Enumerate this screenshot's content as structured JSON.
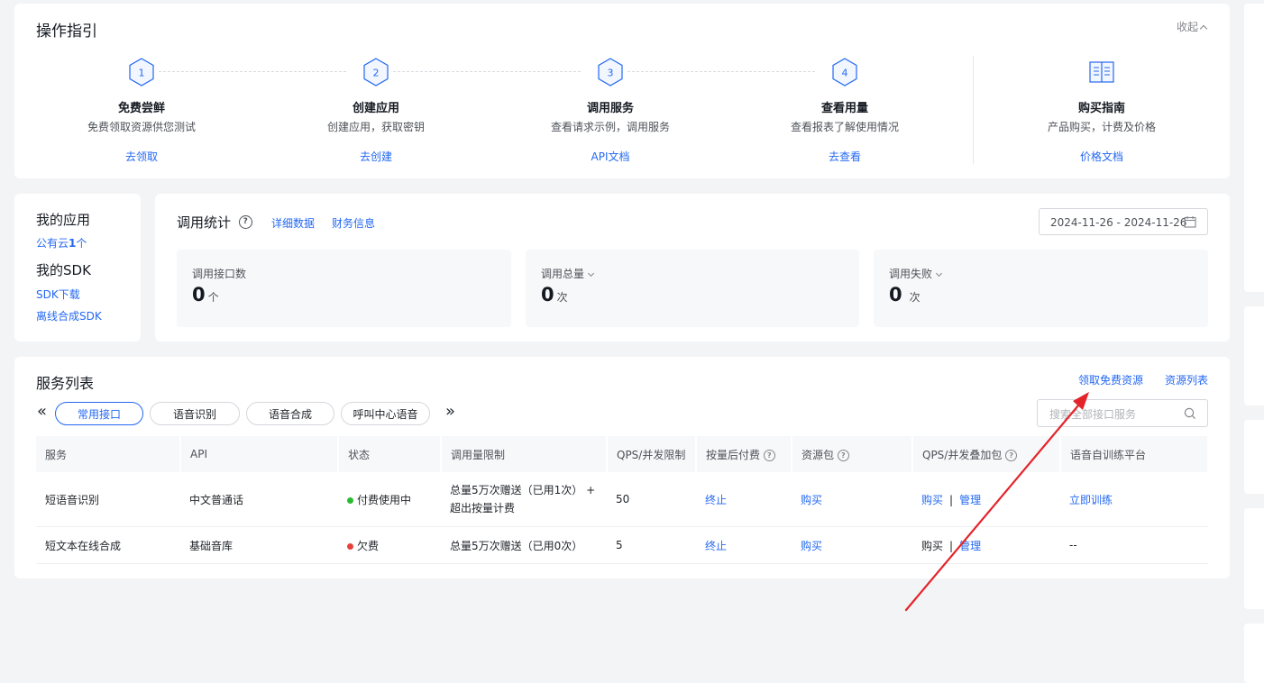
{
  "guide": {
    "title": "操作指引",
    "collapse_label": "收起",
    "steps": [
      {
        "num": "1",
        "title": "免费尝鲜",
        "desc": "免费领取资源供您测试",
        "link": "去领取"
      },
      {
        "num": "2",
        "title": "创建应用",
        "desc": "创建应用，获取密钥",
        "link": "去创建"
      },
      {
        "num": "3",
        "title": "调用服务",
        "desc": "查看请求示例，调用服务",
        "link": "API文档"
      },
      {
        "num": "4",
        "title": "查看用量",
        "desc": "查看报表了解使用情况",
        "link": "去查看"
      }
    ],
    "purchase": {
      "title": "购买指南",
      "desc": "产品购买，计费及价格",
      "link": "价格文档"
    }
  },
  "my_apps": {
    "title": "我的应用",
    "public_cloud_prefix": "公有云",
    "public_cloud_count": "1",
    "public_cloud_suffix": "个",
    "sdk_title": "我的SDK",
    "sdk_download": "SDK下载",
    "offline_sdk": "离线合成SDK"
  },
  "stats": {
    "title": "调用统计",
    "detail_link": "详细数据",
    "finance_link": "财务信息",
    "date_range": "2024-11-26 - 2024-11-26",
    "boxes": [
      {
        "label": "调用接口数",
        "value": "0",
        "unit": "个"
      },
      {
        "label": "调用总量",
        "value": "0",
        "unit": "次"
      },
      {
        "label": "调用失败",
        "value": "0",
        "unit": "次"
      }
    ]
  },
  "services": {
    "title": "服务列表",
    "free_resource_link": "领取免费资源",
    "resource_list_link": "资源列表",
    "nav_prev": "«",
    "nav_next": "»",
    "tabs": [
      "常用接口",
      "语音识别",
      "语音合成",
      "呼叫中心语音"
    ],
    "search_placeholder": "搜索全部接口服务",
    "columns": [
      "服务",
      "API",
      "状态",
      "调用量限制",
      "QPS/并发限制",
      "按量后付费",
      "资源包",
      "QPS/并发叠加包",
      "语音自训练平台"
    ],
    "rows": [
      {
        "service": "短语音识别",
        "api": "中文普通话",
        "status": "付费使用中",
        "status_color": "#2bbb32",
        "quota": "总量5万次赠送（已用1次） + 超出按量计费",
        "qps": "50",
        "postpaid": "终止",
        "package": "购买",
        "qps_buy": "购买",
        "qps_sep": "|",
        "qps_manage": "管理",
        "training": "立即训练"
      },
      {
        "service": "短文本在线合成",
        "api": "基础音库",
        "status": "欠费",
        "status_color": "#e8403a",
        "quota": "总量5万次赠送（已用0次）",
        "qps": "5",
        "postpaid": "终止",
        "package": "购买",
        "qps_buy": "购买",
        "qps_sep": "|",
        "qps_manage": "管理",
        "training": "--"
      }
    ]
  },
  "annotation": {
    "arrow_color": "#e3242b"
  }
}
